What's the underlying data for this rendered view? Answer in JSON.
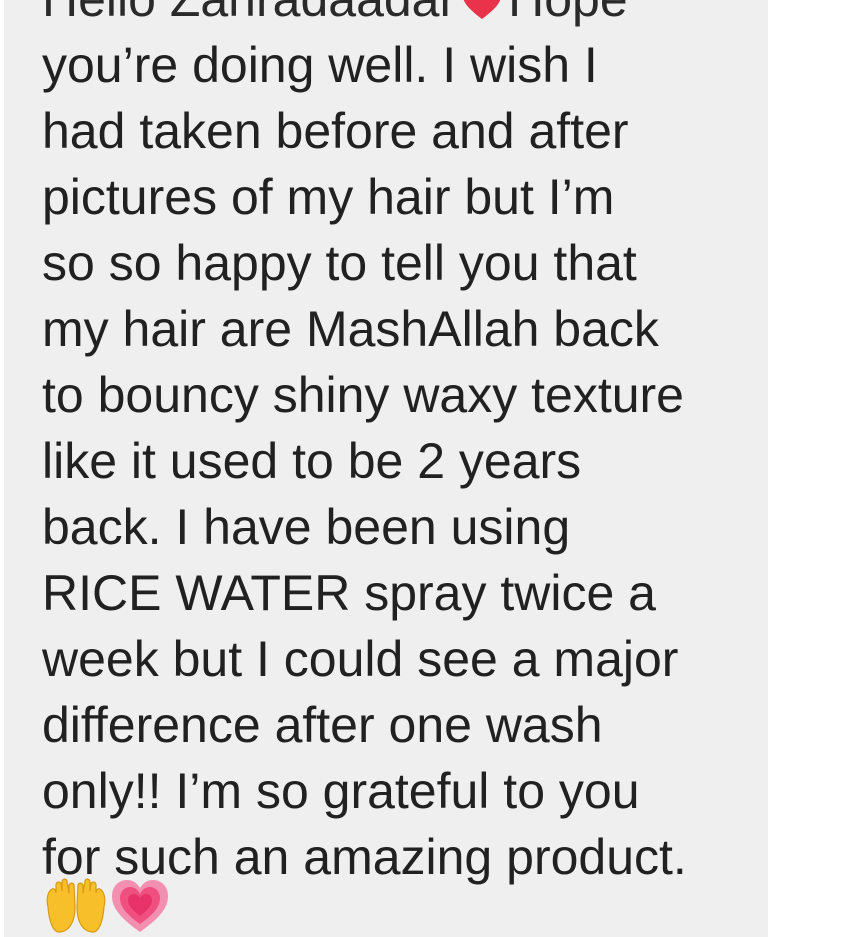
{
  "message": {
    "partial_top_line": {
      "before_heart": "Hello Zahradaadar",
      "after_heart": "Hope"
    },
    "lines": [
      "you’re doing well. I wish I",
      "had taken before and after",
      "pictures of my hair but I’m",
      "so so happy to tell you that",
      "my hair are MashAllah back",
      "to bouncy shiny waxy texture",
      "like it used to be 2 years",
      "back. I have been using",
      "RICE WATER spray twice a",
      "week but I could see a major",
      "difference after one wash",
      "only!! I’m so grateful to you",
      "for such an amazing product."
    ],
    "emojis": [
      "open-hands-icon",
      "growing-heart-icon"
    ]
  },
  "colors": {
    "bubble_background": "#efeff0",
    "text": "#212121",
    "heart_red": "#e8334a",
    "hands_yellow": "#f7c02b",
    "heart_pink": "#f0507f"
  }
}
